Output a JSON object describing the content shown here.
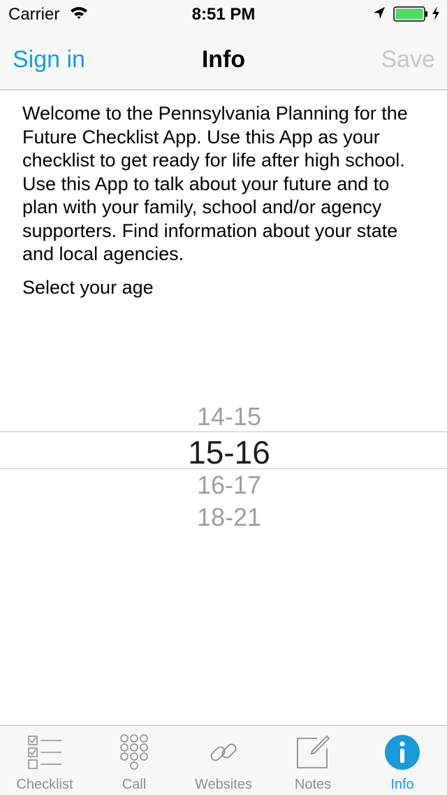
{
  "status_bar": {
    "carrier": "Carrier",
    "time": "8:51 PM"
  },
  "nav": {
    "left_label": "Sign in",
    "title": "Info",
    "right_label": "Save"
  },
  "content": {
    "welcome_text": "Welcome to the Pennsylvania Planning for the Future Checklist App.  Use this App as your checklist to get ready for life after high school.  Use this App to talk about your future and to plan with your family, school and/or agency supporters.  Find information about your state and local agencies.",
    "select_age_label": "Select your age"
  },
  "age_picker": {
    "options": [
      "14-15",
      "15-16",
      "16-17",
      "18-21"
    ],
    "selected": "15-16"
  },
  "tab_bar": {
    "tabs": [
      {
        "label": "Checklist",
        "icon": "checklist-icon",
        "active": false
      },
      {
        "label": "Call",
        "icon": "keypad-icon",
        "active": false
      },
      {
        "label": "Websites",
        "icon": "link-icon",
        "active": false
      },
      {
        "label": "Notes",
        "icon": "notes-icon",
        "active": false
      },
      {
        "label": "Info",
        "icon": "info-icon",
        "active": true
      }
    ]
  },
  "colors": {
    "accent": "#1a9bd7",
    "disabled": "#c7c7c9",
    "battery": "#4cd964",
    "bar_background": "#f7f7f7"
  }
}
